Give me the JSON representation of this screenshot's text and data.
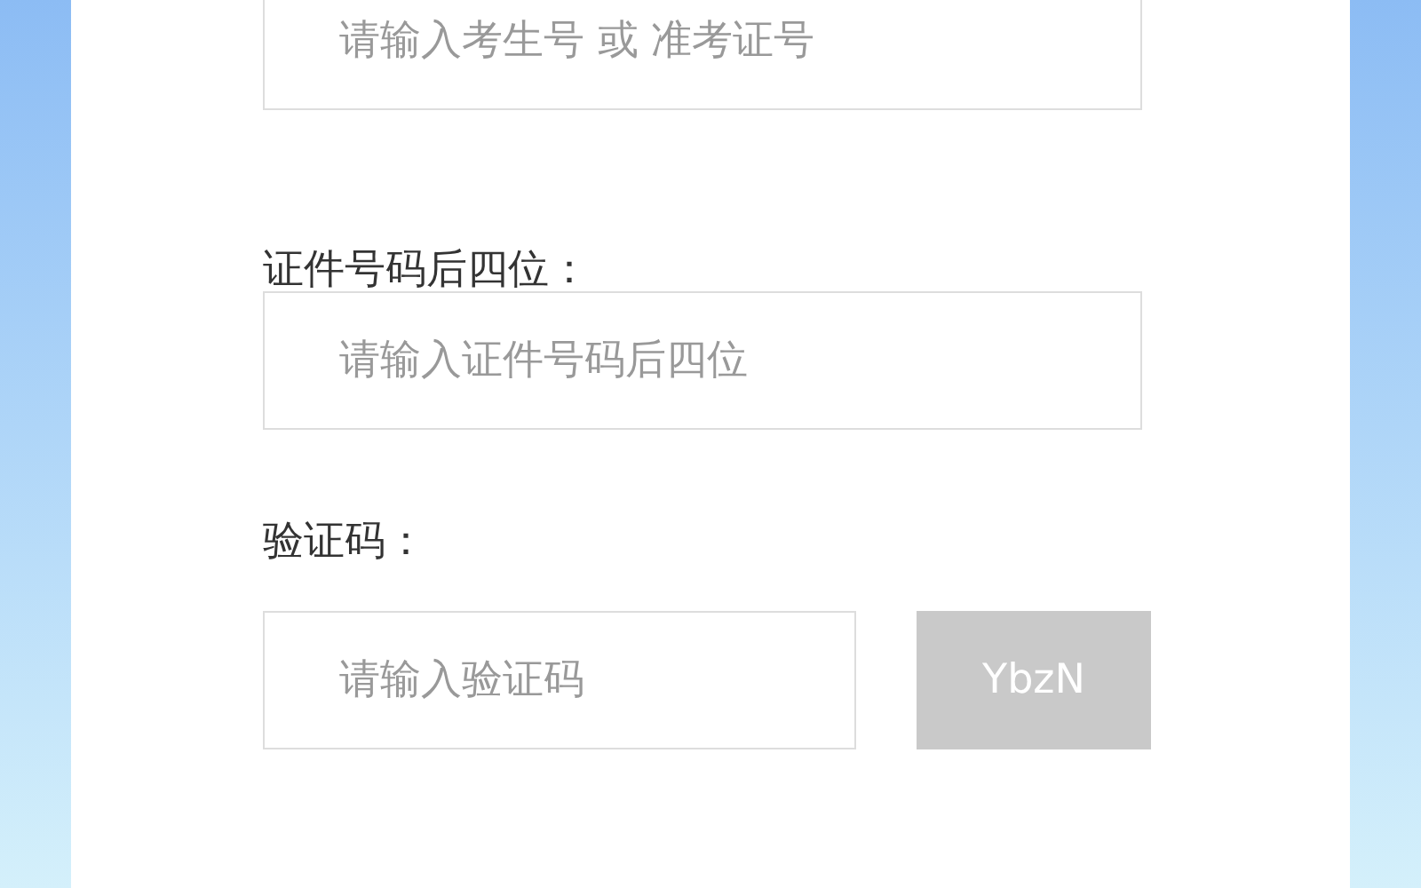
{
  "fields": [
    {
      "kind": "input",
      "placeholder": "请输入考生号 或 准考证号"
    },
    {
      "kind": "input",
      "label": "证件号码后四位：",
      "placeholder": "请输入证件号码后四位"
    },
    {
      "kind": "captcha",
      "label": "验证码：",
      "placeholder": "请输入验证码",
      "captcha": "YbzN"
    }
  ]
}
